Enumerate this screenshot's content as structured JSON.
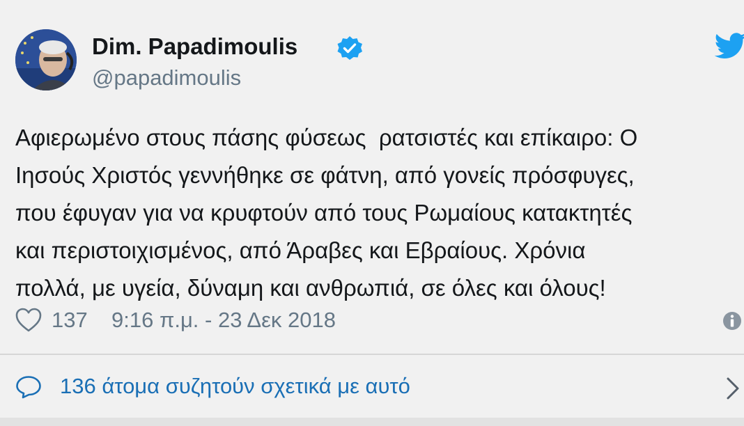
{
  "author": {
    "display_name": "Dim. Papadimoulis",
    "handle": "@papadimoulis",
    "verified": true
  },
  "tweet": {
    "lines": [
      "Αφιερωμένο στους πάσης φύσεως  ρατσιστές και επίκαιρο: Ο",
      "Ιησούς Χριστός γεννήθηκε σε φάτνη, από γονείς πρόσφυγες,",
      "που έφυγαν για να κρυφτούν από τους Ρωμαίους κατακτητές",
      "και περιστοιχισμένος, από Άραβες και Εβραίους. Χρόνια",
      "πολλά, με υγεία, δύναμη και ανθρωπιά, σε όλες και όλους!"
    ]
  },
  "meta": {
    "like_count": "137",
    "timestamp": "9:16 π.μ. - 23 Δεκ 2018"
  },
  "discussion": {
    "label": "136 άτομα συζητούν σχετικά με αυτό"
  },
  "icons": {
    "verified": "verified-badge-icon",
    "brand": "twitter-bird-icon",
    "like": "heart-icon",
    "info": "info-icon",
    "reply": "comment-bubble-icon",
    "more": "chevron-right-icon"
  },
  "colors": {
    "brand": "#1da1f2",
    "link": "#1a6fb5",
    "secondary_text": "#657786",
    "primary_text": "#14171a"
  }
}
